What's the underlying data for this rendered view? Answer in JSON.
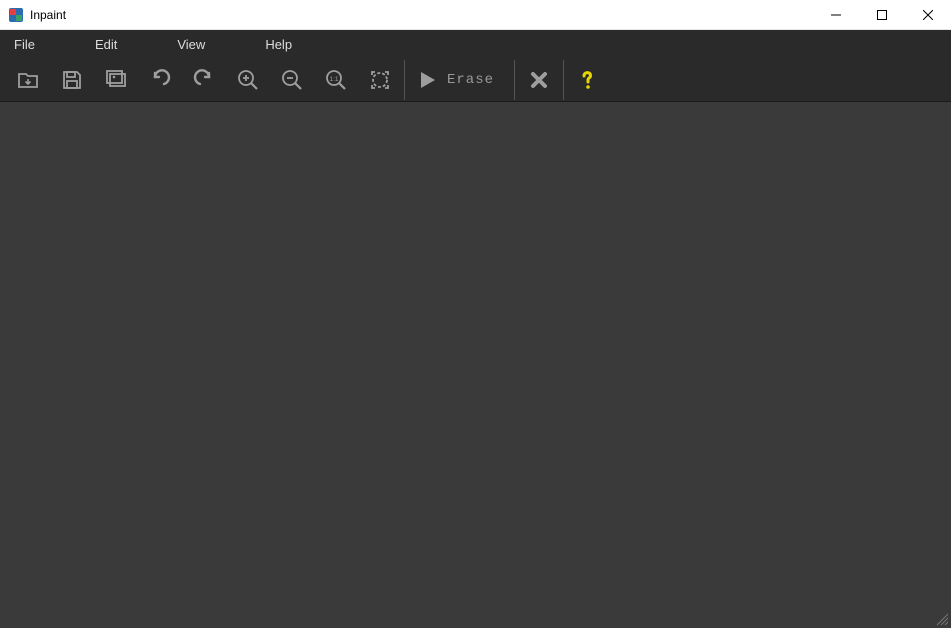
{
  "window": {
    "title": "Inpaint"
  },
  "menubar": {
    "items": [
      "File",
      "Edit",
      "View",
      "Help"
    ]
  },
  "toolbar": {
    "erase_label": "Erase"
  },
  "colors": {
    "icon_gray": "#9e9e9e",
    "help_yellow": "#e6d500",
    "titlebar_bg": "#ffffff",
    "dark_bg": "#2a2a2a",
    "canvas_bg": "#3a3a3a"
  }
}
